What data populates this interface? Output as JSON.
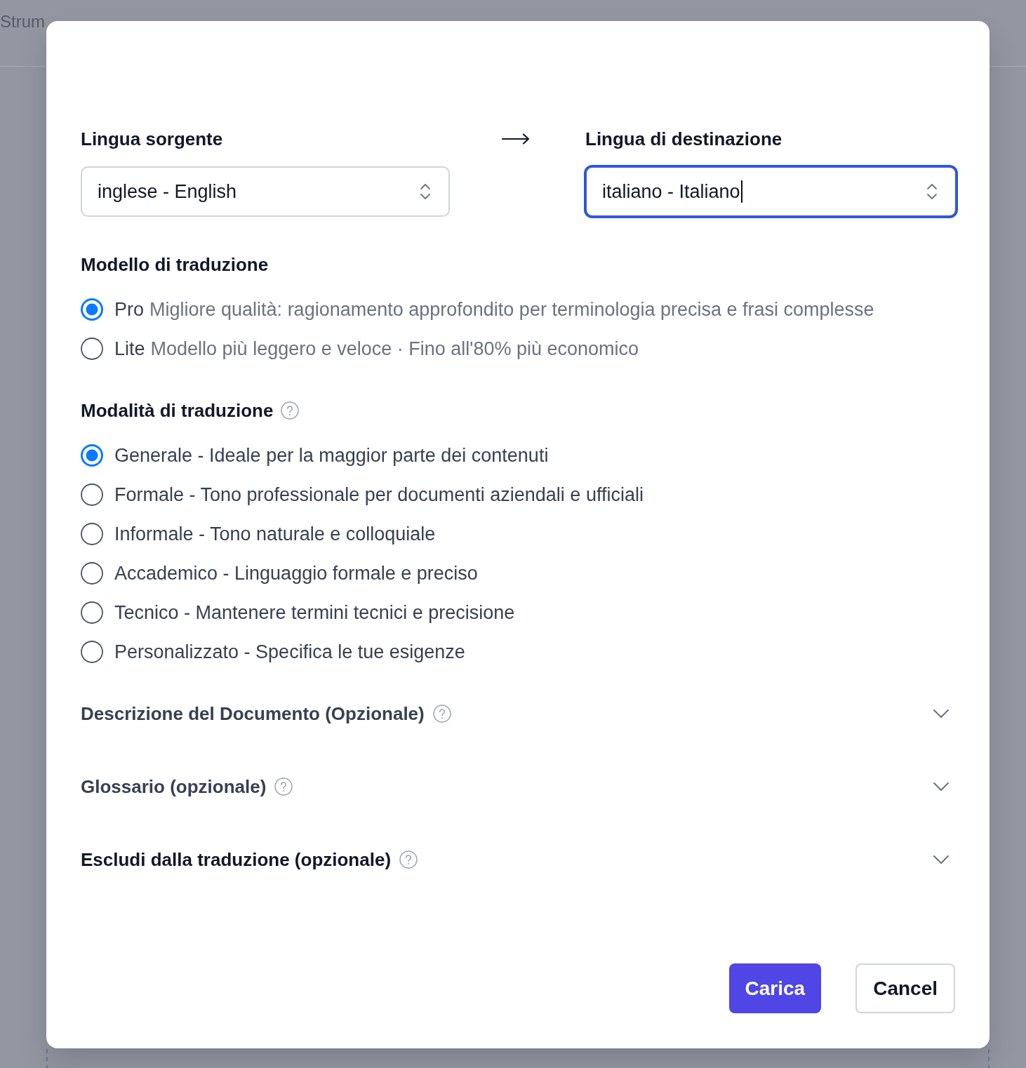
{
  "background": {
    "nav_item": "Strum"
  },
  "source_language": {
    "label": "Lingua sorgente",
    "value": "inglese - English",
    "focused": false
  },
  "target_language": {
    "label": "Lingua di destinazione",
    "value": "italiano - Italiano",
    "focused": true
  },
  "translation_model": {
    "heading": "Modello di traduzione",
    "options": [
      {
        "name": "Pro",
        "description": "Migliore qualità: ragionamento approfondito per terminologia precisa e frasi complesse",
        "selected": true
      },
      {
        "name": "Lite",
        "description": "Modello più leggero e veloce · Fino all'80% più economico",
        "selected": false
      }
    ]
  },
  "translation_mode": {
    "heading": "Modalità di traduzione",
    "options": [
      {
        "label": "Generale - Ideale per la maggior parte dei contenuti",
        "selected": true
      },
      {
        "label": "Formale - Tono professionale per documenti aziendali e ufficiali",
        "selected": false
      },
      {
        "label": "Informale - Tono naturale e colloquiale",
        "selected": false
      },
      {
        "label": "Accademico - Linguaggio formale e preciso",
        "selected": false
      },
      {
        "label": "Tecnico - Mantenere termini tecnici e precisione",
        "selected": false
      },
      {
        "label": "Personalizzato - Specifica le tue esigenze",
        "selected": false
      }
    ]
  },
  "sections": [
    {
      "title": "Descrizione del Documento (Opzionale)",
      "expanded": false,
      "hovered": false
    },
    {
      "title": "Glossario (opzionale)",
      "expanded": false,
      "hovered": false
    },
    {
      "title": "Escludi dalla traduzione (opzionale)",
      "expanded": false,
      "hovered": true
    }
  ],
  "buttons": [
    {
      "label": "Carica",
      "kind": "primary"
    },
    {
      "label": "Cancel",
      "kind": "secondary"
    }
  ]
}
